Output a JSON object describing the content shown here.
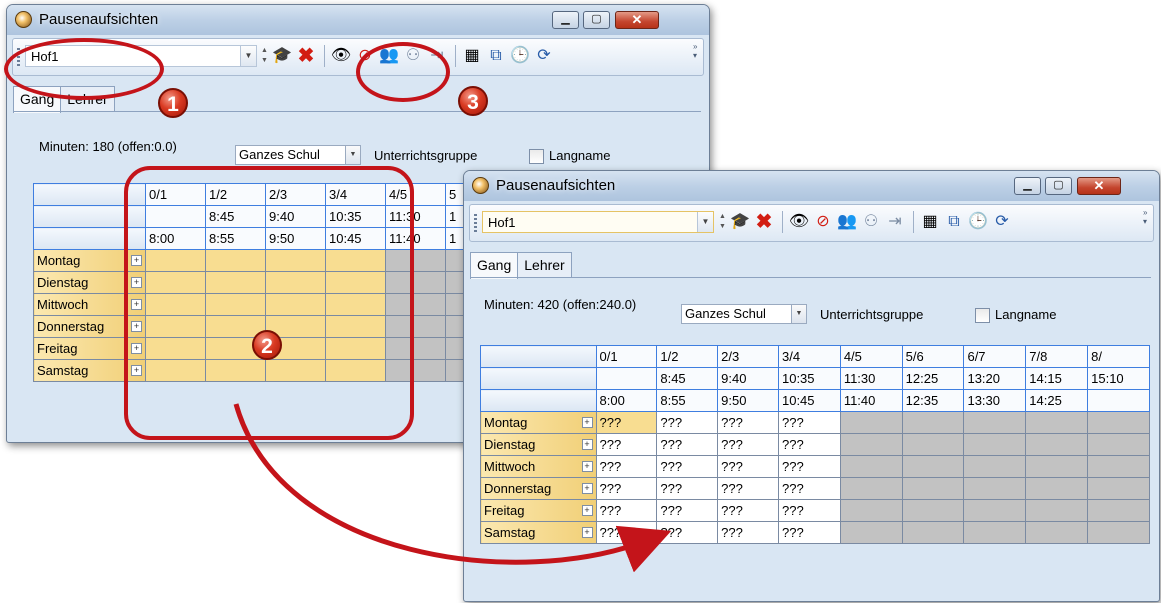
{
  "back_window": {
    "title": "Pausenaufsichten",
    "toolbar_value": "Hof1",
    "tabs": [
      "Gang",
      "Lehrer"
    ],
    "minutes_text": "Minuten: 180 (offen:0.0)",
    "group_select": "Ganzes Schul",
    "group_label": "Unterrichtsgruppe",
    "longname_label": "Langname",
    "columns": [
      "0/1",
      "1/2",
      "2/3",
      "3/4",
      "4/5",
      "5"
    ],
    "row_end_times": [
      "",
      "8:45",
      "9:40",
      "10:35",
      "11:30",
      "1"
    ],
    "row_start_times": [
      "8:00",
      "8:55",
      "9:50",
      "10:45",
      "11:40",
      "1"
    ],
    "days": [
      "Montag",
      "Dienstag",
      "Mittwoch",
      "Donnerstag",
      "Freitag",
      "Samstag"
    ]
  },
  "front_window": {
    "title": "Pausenaufsichten",
    "toolbar_value": "Hof1",
    "tabs": [
      "Gang",
      "Lehrer"
    ],
    "minutes_text": "Minuten: 420 (offen:240.0)",
    "group_select": "Ganzes Schul",
    "group_label": "Unterrichtsgruppe",
    "longname_label": "Langname",
    "columns": [
      "0/1",
      "1/2",
      "2/3",
      "3/4",
      "4/5",
      "5/6",
      "6/7",
      "7/8",
      "8/"
    ],
    "row_end_times": [
      "",
      "8:45",
      "9:40",
      "10:35",
      "11:30",
      "12:25",
      "13:20",
      "14:15",
      "15:10"
    ],
    "row_start_times": [
      "8:00",
      "8:55",
      "9:50",
      "10:45",
      "11:40",
      "12:35",
      "13:30",
      "14:25",
      ""
    ],
    "days": [
      "Montag",
      "Dienstag",
      "Mittwoch",
      "Donnerstag",
      "Freitag",
      "Samstag"
    ],
    "cell_value": "???"
  },
  "toolbar_icons": [
    "spin-updown-icon",
    "teacher-hat-icon",
    "delete-x-icon",
    "eye-icon",
    "eye-crossed-icon",
    "users-icon",
    "user-assign-icon",
    "arrow-bar-icon",
    "calculator-icon",
    "grid-transfer-icon",
    "clock-icon",
    "refresh-icon"
  ],
  "window_buttons": [
    "minimize",
    "maximize",
    "close"
  ],
  "annotations": [
    "1",
    "2",
    "3"
  ],
  "colors": {
    "annotation_red": "#c4141a",
    "period_yellow": "#f8dd91",
    "blocked_gray": "#c2c2c2",
    "header_blue": "#3f7ee0"
  }
}
